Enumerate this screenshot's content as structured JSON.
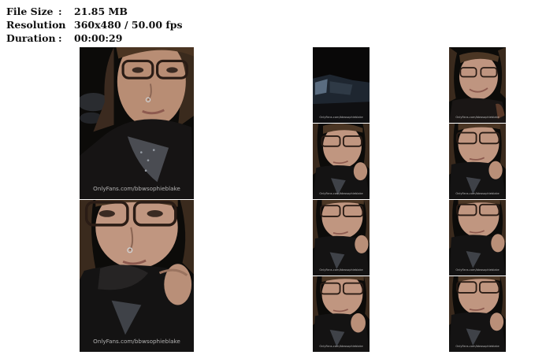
{
  "info": {
    "file_size_label": "File Size",
    "file_size_value": "21.85 MB",
    "resolution_label": "Resolution",
    "resolution_value": "360x480 / 50.00 fps",
    "duration_label": "Duration",
    "duration_value": "00:00:29",
    "separator": ":"
  },
  "watermark": "OnlyFans.com/bbwsophieblake",
  "frames": [
    {
      "id": "large-1",
      "variant": "face-glasses"
    },
    {
      "id": "large-2",
      "variant": "face-hand"
    },
    {
      "id": "col2-1",
      "variant": "car-interior"
    },
    {
      "id": "col2-2",
      "variant": "face-hand"
    },
    {
      "id": "col2-3",
      "variant": "face-hand"
    },
    {
      "id": "col2-4",
      "variant": "face-hand"
    },
    {
      "id": "col3-1",
      "variant": "face-smile"
    },
    {
      "id": "col3-2",
      "variant": "face-hand"
    },
    {
      "id": "col3-3",
      "variant": "face-hand"
    },
    {
      "id": "col3-4",
      "variant": "face-hand"
    }
  ]
}
